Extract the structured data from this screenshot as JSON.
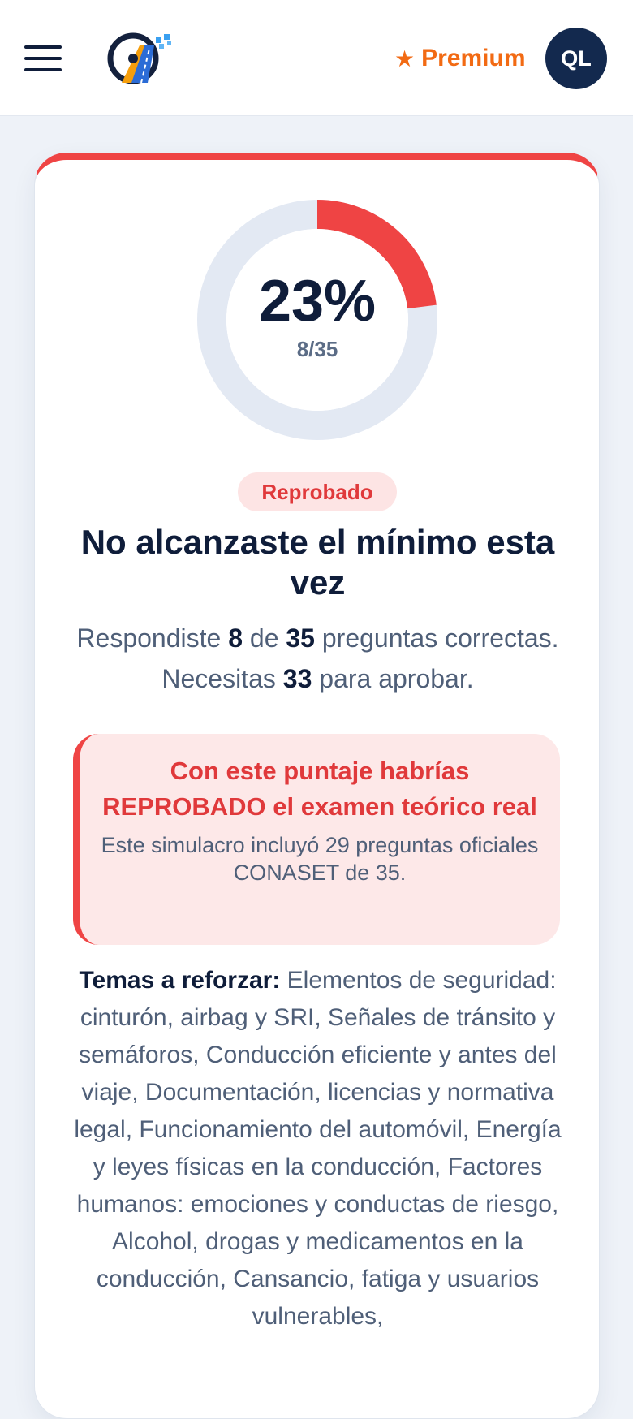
{
  "header": {
    "premium_label": "Premium",
    "premium_icon": "star-icon",
    "avatar_initials": "QL",
    "menu_icon": "hamburger-menu-icon",
    "logo": "road-steering-wheel-logo"
  },
  "result": {
    "percent_text": "23%",
    "percent_value": 0.23,
    "fraction_text": "8/35",
    "status_badge": "Reprobado",
    "title": "No alcanzaste el mínimo esta vez",
    "summary": {
      "prefix": "Respondiste",
      "correct": "8",
      "of_word": "de",
      "total": "35",
      "middle": "preguntas correctas. Necesitas",
      "required": "33",
      "suffix": "para aprobar."
    },
    "alert": {
      "title": "Con este puntaje habrías REPROBADO el examen teórico real",
      "subtitle": "Este simulacro incluyó 29 preguntas oficiales CONASET de 35."
    },
    "topics": {
      "label": "Temas a reforzar:",
      "text": "Elementos de seguridad: cinturón, airbag y SRI, Señales de tránsito y semáforos, Conducción eficiente y antes del viaje, Documentación, licencias y normativa legal, Funcionamiento del automóvil, Energía y leyes físicas en la conducción, Factores humanos: emociones y conductas de riesgo, Alcohol, drogas y medicamentos en la conducción, Cansancio, fatiga y usuarios vulnerables,"
    }
  },
  "colors": {
    "accent_red": "#ef4444",
    "ring_track": "#e3e9f3",
    "premium_orange": "#f26a13",
    "avatar_bg": "#13294e"
  }
}
